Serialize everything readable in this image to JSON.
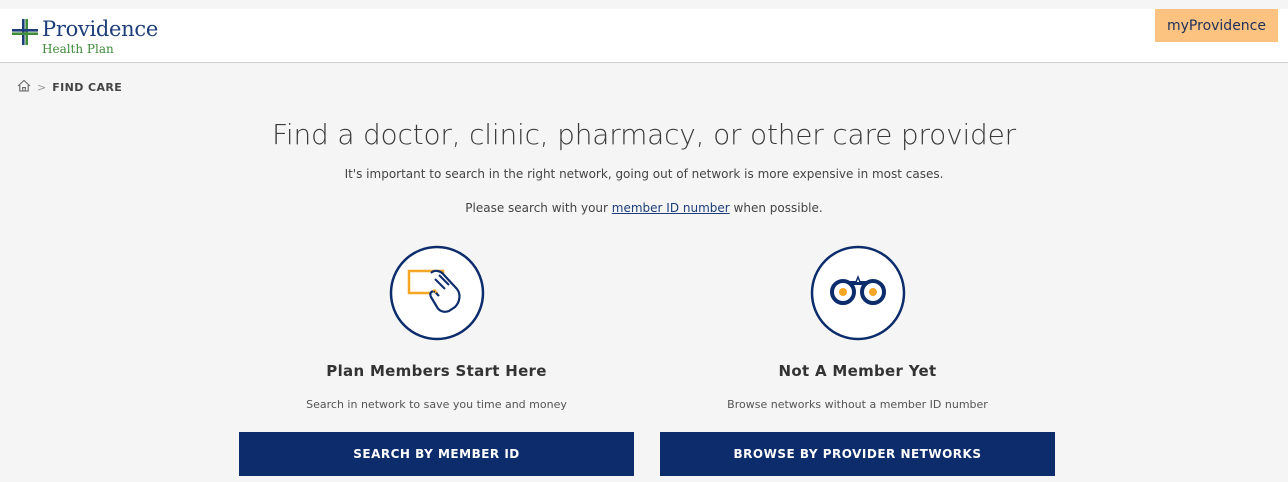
{
  "header": {
    "logo_name": "Providence",
    "logo_sub": "Health Plan",
    "my_button": "myProvidence"
  },
  "breadcrumb": {
    "home_icon": "home-icon",
    "separator": ">",
    "current": "FIND CARE"
  },
  "main": {
    "title": "Find a doctor, clinic, pharmacy, or other care provider",
    "subtitle": "It's important to search in the right network, going out of network is more expensive in most cases.",
    "hint_prefix": "Please search with your ",
    "hint_link": "member ID number",
    "hint_suffix": " when possible."
  },
  "cards": [
    {
      "icon": "member-card-hand-icon",
      "title": "Plan Members Start Here",
      "description": "Search in network to save you time and money",
      "button": "SEARCH BY MEMBER ID"
    },
    {
      "icon": "binoculars-icon",
      "title": "Not A Member Yet",
      "description": "Browse networks without a member ID number",
      "button": "BROWSE BY PROVIDER NETWORKS"
    }
  ],
  "colors": {
    "brand_blue": "#0c2c6c",
    "accent_orange": "#f5a623",
    "brand_green": "#3f8b3a",
    "my_button_bg": "#fcc380"
  }
}
